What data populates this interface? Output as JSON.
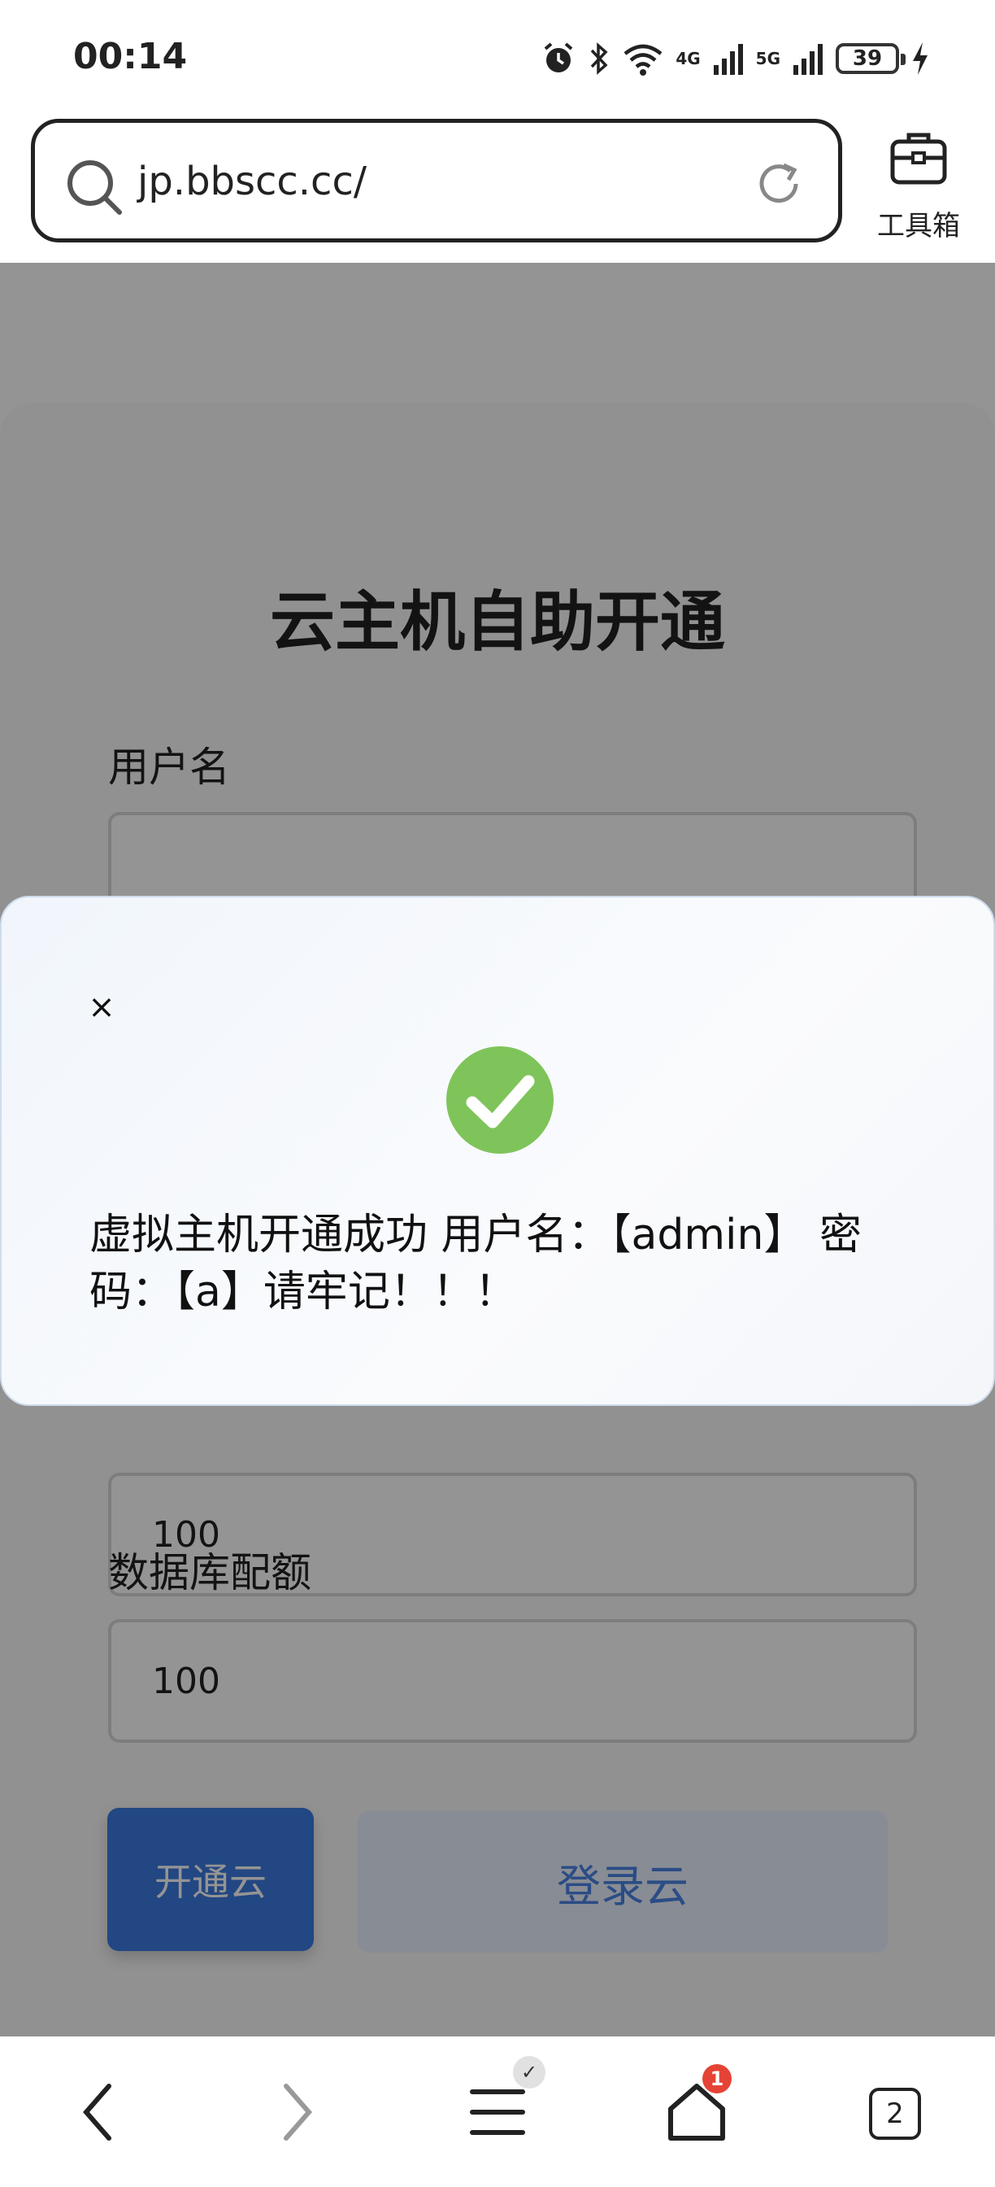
{
  "status_bar": {
    "time": "00:14",
    "network_1": "4G",
    "network_2": "5G",
    "battery": "39"
  },
  "browser": {
    "url": "jp.bbscc.cc/",
    "toolbox_label": "工具箱"
  },
  "page": {
    "title": "云主机自助开通",
    "fields": [
      {
        "label": "用户名",
        "value": ""
      },
      {
        "label": "",
        "value": "100"
      },
      {
        "label": "数据库配额",
        "value": "100"
      }
    ],
    "primary_button": "开通云",
    "secondary_button": "登录云"
  },
  "modal": {
    "close_symbol": "×",
    "message": "虚拟主机开通成功 用户名：【admin】 密码：【a】请牢记！！！"
  },
  "bottom_nav": {
    "tab_count": "2",
    "home_badge": "1",
    "menu_badge": "✓"
  },
  "colors": {
    "primary": "#3c7ae0",
    "success": "#7ec45a",
    "badge": "#e54335"
  }
}
